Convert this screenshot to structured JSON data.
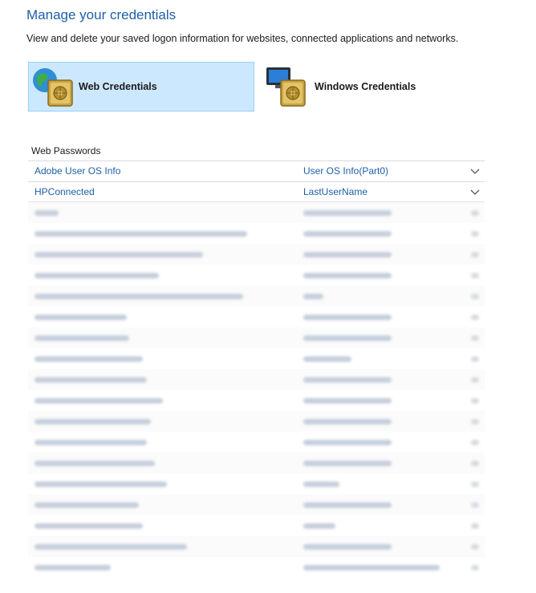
{
  "page": {
    "title": "Manage your credentials",
    "subtitle": "View and delete your saved logon information for websites, connected applications and networks."
  },
  "tabs": {
    "web": "Web Credentials",
    "windows": "Windows Credentials"
  },
  "section": {
    "label": "Web Passwords"
  },
  "credentials": [
    {
      "site": "Adobe User OS Info",
      "user": "User OS Info(Part0)"
    },
    {
      "site": "HPConnected",
      "user": "LastUserName"
    }
  ],
  "obscured_rows": 18,
  "colors": {
    "accent": "#1e5fa8",
    "selected_bg": "#cce8ff",
    "selected_border": "#99d1ff"
  },
  "icons": [
    "web-credentials-vault-icon",
    "windows-credentials-vault-icon",
    "chevron-down-icon"
  ]
}
